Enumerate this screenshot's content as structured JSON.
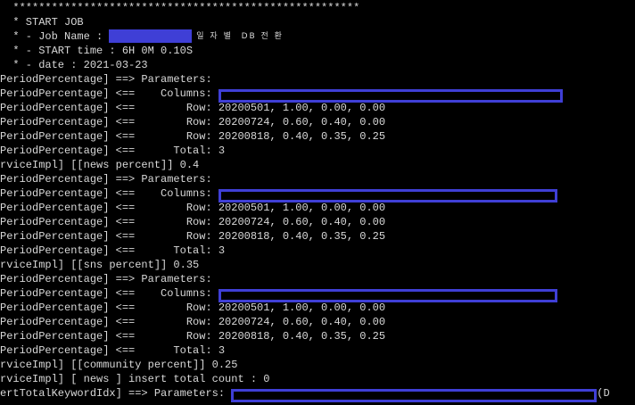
{
  "theme": {
    "background": "#000000",
    "text_color": "#d8d8d8",
    "redaction_color": "#3f3fd6"
  },
  "lines": [
    {
      "segs": [
        {
          "t": "text",
          "v": "  ******************************************************"
        }
      ]
    },
    {
      "segs": [
        {
          "t": "text",
          "v": "  * START JOB"
        }
      ]
    },
    {
      "segs": [
        {
          "t": "text",
          "v": "  * - Job Name : "
        },
        {
          "t": "fill",
          "w": 93
        },
        {
          "t": "hangul",
          "v": " 일 자 별  DB 전 환"
        }
      ]
    },
    {
      "segs": [
        {
          "t": "text",
          "v": "  * - START time : 6H 0M 0.10S"
        }
      ]
    },
    {
      "segs": [
        {
          "t": "text",
          "v": "  * - date : 2021-03-23"
        }
      ]
    },
    {
      "segs": [
        {
          "t": "text",
          "v": "PeriodPercentage] ==> Parameters: "
        }
      ]
    },
    {
      "segs": [
        {
          "t": "text",
          "v": "PeriodPercentage] <==    Columns: "
        },
        {
          "t": "box",
          "w": 386
        }
      ]
    },
    {
      "segs": [
        {
          "t": "text",
          "v": "PeriodPercentage] <==        Row: 20200501, 1.00, 0.00, 0.00"
        }
      ]
    },
    {
      "segs": [
        {
          "t": "text",
          "v": "PeriodPercentage] <==        Row: 20200724, 0.60, 0.40, 0.00"
        }
      ]
    },
    {
      "segs": [
        {
          "t": "text",
          "v": "PeriodPercentage] <==        Row: 20200818, 0.40, 0.35, 0.25"
        }
      ]
    },
    {
      "segs": [
        {
          "t": "text",
          "v": "PeriodPercentage] <==      Total: 3"
        }
      ]
    },
    {
      "segs": [
        {
          "t": "text",
          "v": "rviceImpl] [[news percent]] 0.4"
        }
      ]
    },
    {
      "segs": [
        {
          "t": "text",
          "v": "PeriodPercentage] ==> Parameters: "
        }
      ]
    },
    {
      "segs": [
        {
          "t": "text",
          "v": "PeriodPercentage] <==    Columns: "
        },
        {
          "t": "box",
          "w": 380
        }
      ]
    },
    {
      "segs": [
        {
          "t": "text",
          "v": "PeriodPercentage] <==        Row: 20200501, 1.00, 0.00, 0.00"
        }
      ]
    },
    {
      "segs": [
        {
          "t": "text",
          "v": "PeriodPercentage] <==        Row: 20200724, 0.60, 0.40, 0.00"
        }
      ]
    },
    {
      "segs": [
        {
          "t": "text",
          "v": "PeriodPercentage] <==        Row: 20200818, 0.40, 0.35, 0.25"
        }
      ]
    },
    {
      "segs": [
        {
          "t": "text",
          "v": "PeriodPercentage] <==      Total: 3"
        }
      ]
    },
    {
      "segs": [
        {
          "t": "text",
          "v": "rviceImpl] [[sns percent]] 0.35"
        }
      ]
    },
    {
      "segs": [
        {
          "t": "text",
          "v": "PeriodPercentage] ==> Parameters: "
        }
      ]
    },
    {
      "segs": [
        {
          "t": "text",
          "v": "PeriodPercentage] <==    Columns: "
        },
        {
          "t": "box",
          "w": 380
        }
      ]
    },
    {
      "segs": [
        {
          "t": "text",
          "v": "PeriodPercentage] <==        Row: 20200501, 1.00, 0.00, 0.00"
        }
      ]
    },
    {
      "segs": [
        {
          "t": "text",
          "v": "PeriodPercentage] <==        Row: 20200724, 0.60, 0.40, 0.00"
        }
      ]
    },
    {
      "segs": [
        {
          "t": "text",
          "v": "PeriodPercentage] <==        Row: 20200818, 0.40, 0.35, 0.25"
        }
      ]
    },
    {
      "segs": [
        {
          "t": "text",
          "v": "PeriodPercentage] <==      Total: 3"
        }
      ]
    },
    {
      "segs": [
        {
          "t": "text",
          "v": "rviceImpl] [[community percent]] 0.25"
        }
      ]
    },
    {
      "segs": [
        {
          "t": "text",
          "v": "rviceImpl] [ news ] insert total count : 0"
        }
      ]
    },
    {
      "segs": [
        {
          "t": "text",
          "v": "ertTotalKeywordIdx] ==> Parameters: "
        },
        {
          "t": "box",
          "w": 410
        },
        {
          "t": "text",
          "v": "(D"
        }
      ]
    }
  ]
}
